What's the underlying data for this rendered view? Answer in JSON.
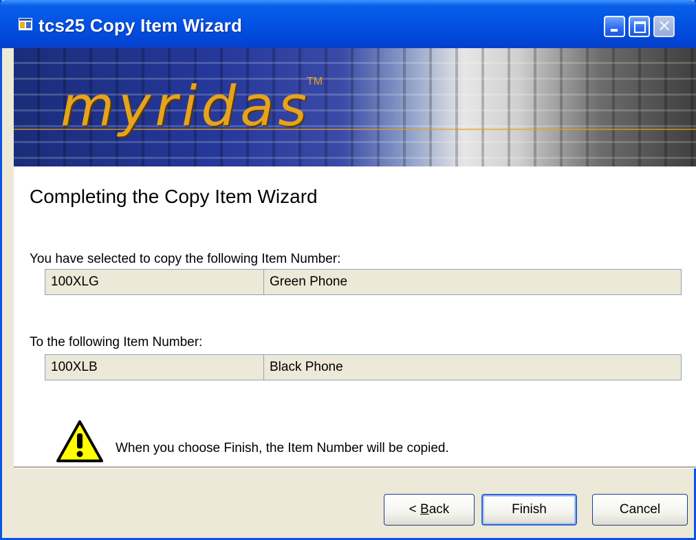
{
  "window": {
    "title": "tcs25 Copy Item Wizard"
  },
  "banner": {
    "logo_text": "myridas",
    "trademark": "TM"
  },
  "page": {
    "heading": "Completing the Copy Item Wizard",
    "source_label": "You have selected to copy the following Item Number:",
    "source": {
      "item_number": "100XLG",
      "description": "Green Phone"
    },
    "target_label": "To the following Item Number:",
    "target": {
      "item_number": "100XLB",
      "description": "Black Phone"
    },
    "warning_text": "When you choose Finish, the Item Number will be copied."
  },
  "buttons": {
    "back_prefix": "< ",
    "back_accel": "B",
    "back_rest": "ack",
    "finish": "Finish",
    "cancel": "Cancel"
  },
  "icons": {
    "title": "wizard-app-icon",
    "warning": "warning-icon",
    "minimize": "minimize-icon",
    "maximize": "maximize-icon",
    "close": "close-icon"
  },
  "colors": {
    "titlebar": "#0353e3",
    "logo": "#e6a31e",
    "field_bg": "#ece9d8",
    "warning": "#ffff00"
  }
}
